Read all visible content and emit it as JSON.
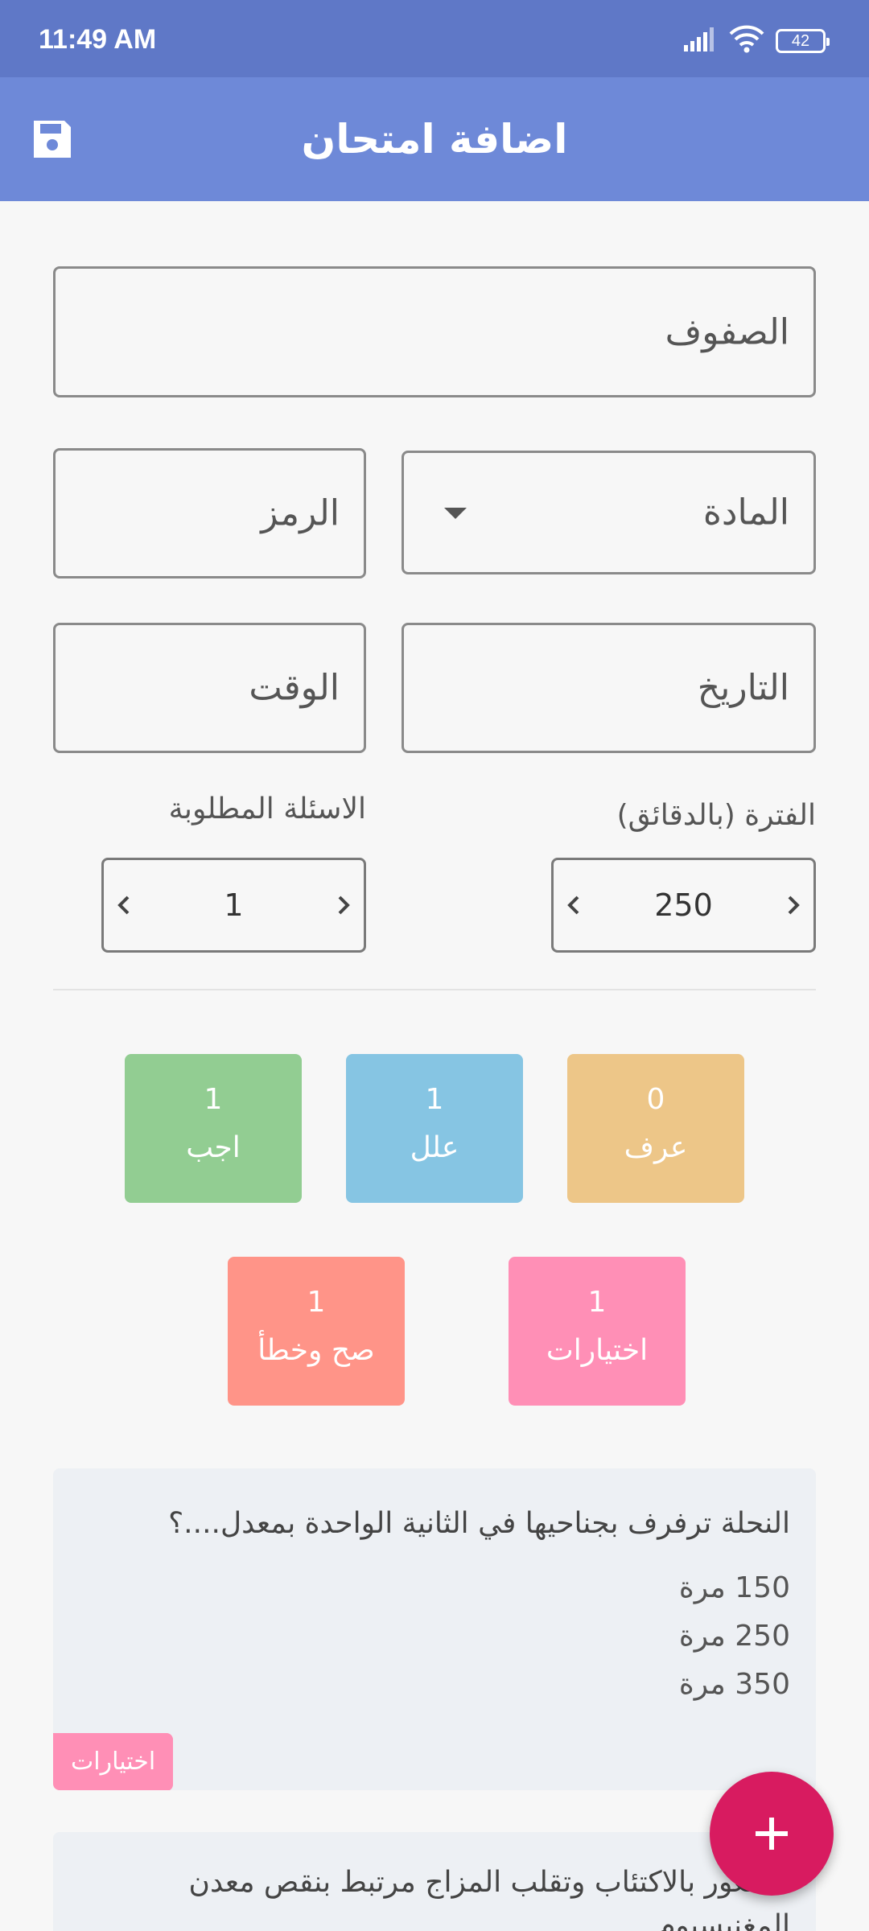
{
  "status_bar": {
    "time": "11:49 AM",
    "battery": "42",
    "icons": [
      "signal-icon",
      "wifi-icon",
      "battery-icon"
    ]
  },
  "app_bar": {
    "title": "اضافة امتحان",
    "save_icon": "floppy-disk-icon"
  },
  "form": {
    "grades_label": "الصفوف",
    "subject_label": "المادة",
    "code_label": "الرمز",
    "date_label": "التاريخ",
    "time_label": "الوقت",
    "duration_caption": "الفترة (بالدقائق)",
    "duration_value": "250",
    "required_caption": "الاسئلة المطلوبة",
    "required_value": "1"
  },
  "question_types": [
    {
      "count": "0",
      "label": "عرف",
      "color": "#edc688"
    },
    {
      "count": "1",
      "label": "علل",
      "color": "#86c5e3"
    },
    {
      "count": "1",
      "label": "اجب",
      "color": "#92cd92"
    },
    {
      "count": "1",
      "label": "اختيارات",
      "color": "#ff8fb6"
    },
    {
      "count": "1",
      "label": "صح وخطأ",
      "color": "#ff9488"
    }
  ],
  "questions": [
    {
      "text": "النحلة ترفرف بجناحيها في الثانية الواحدة بمعدل....؟",
      "options": [
        "150 مرة",
        "250 مرة",
        "350 مرة"
      ],
      "tag": "اختيارات"
    },
    {
      "text": "الشعور بالاكتئاب وتقلب المزاج مرتبط بنقص معدن المغنيسيوم"
    }
  ],
  "fab": {
    "icon": "plus-icon"
  }
}
